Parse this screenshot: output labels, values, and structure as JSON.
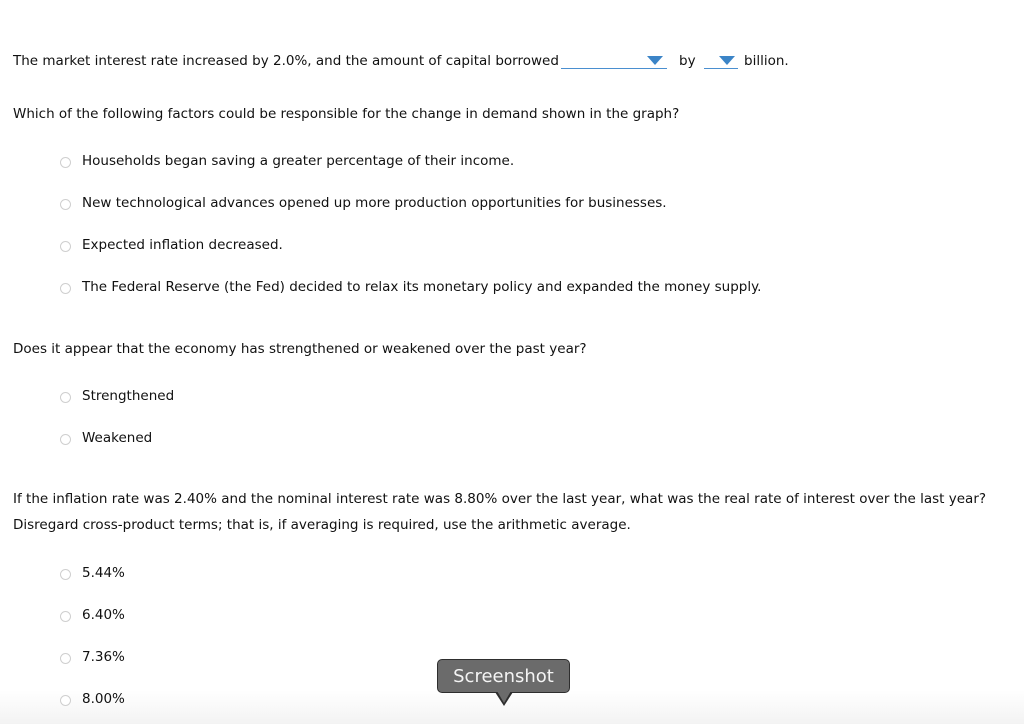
{
  "q1": {
    "sentence_start": "The market interest rate increased by 2.0%, and the amount of capital borrowed",
    "direction_dropdown": {
      "selected": ""
    },
    "connector": "by",
    "amount_dropdown": {
      "selected": ""
    },
    "sentence_end": "billion."
  },
  "q2": {
    "prompt": "Which of the following factors could be responsible for the change in demand shown in the graph?",
    "options": [
      {
        "label": "Households began saving a greater percentage of their income.",
        "selected": false
      },
      {
        "label": "New technological advances opened up more production opportunities for businesses.",
        "selected": false
      },
      {
        "label": "Expected inflation decreased.",
        "selected": false
      },
      {
        "label": "The Federal Reserve (the Fed) decided to relax its monetary policy and expanded the money supply.",
        "selected": false
      }
    ]
  },
  "q3": {
    "prompt": "Does it appear that the economy has strengthened or weakened over the past year?",
    "options": [
      {
        "label": "Strengthened",
        "selected": false
      },
      {
        "label": "Weakened",
        "selected": false
      }
    ]
  },
  "q4": {
    "prompt_line1": "If the inflation rate was 2.40% and the nominal interest rate was 8.80% over the last year, what was the real rate of interest over the last year?",
    "prompt_line2": "Disregard cross-product terms; that is, if averaging is required, use the arithmetic average.",
    "options": [
      {
        "label": "5.44%",
        "selected": false
      },
      {
        "label": "6.40%",
        "selected": false
      },
      {
        "label": "7.36%",
        "selected": false
      },
      {
        "label": "8.00%",
        "selected": false
      }
    ]
  },
  "tooltip": {
    "label": "Screenshot"
  },
  "colors": {
    "dropdown_accent": "#3b84c7",
    "tooltip_bg": "#6b6b6b"
  }
}
